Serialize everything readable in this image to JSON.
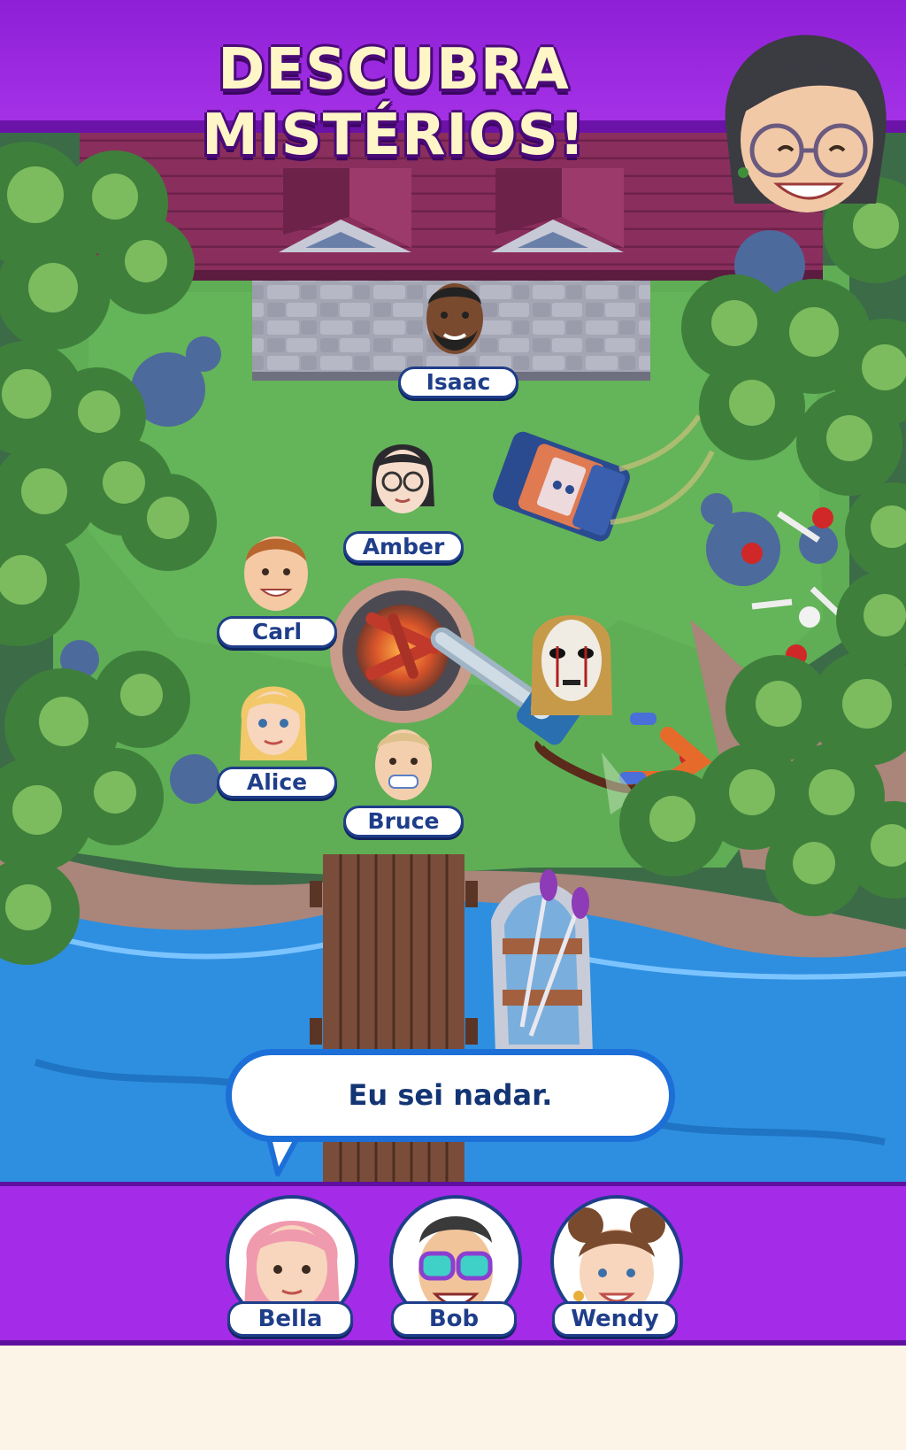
{
  "banner": {
    "title": "DESCUBRA MISTÉRIOS!"
  },
  "characters": [
    {
      "name": "Isaac"
    },
    {
      "name": "Amber"
    },
    {
      "name": "Carl"
    },
    {
      "name": "Alice"
    },
    {
      "name": "Bruce"
    }
  ],
  "dialogue": {
    "text": "Eu sei nadar."
  },
  "suspects": [
    {
      "name": "Bella"
    },
    {
      "name": "Bob"
    },
    {
      "name": "Wendy"
    }
  ],
  "colors": {
    "banner": "#9a28dd",
    "grass": "#5fae55",
    "water": "#2e8fe0",
    "roof": "#8a2f5d",
    "tag_border": "#1f3e8a",
    "bubble_border": "#1d6fd8"
  }
}
